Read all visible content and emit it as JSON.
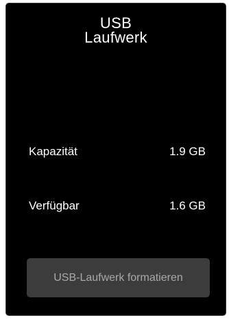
{
  "dialog": {
    "title_line1": "USB",
    "title_line2": "Laufwerk"
  },
  "info": {
    "capacity_label": "Kapazität",
    "capacity_value": "1.9 GB",
    "available_label": "Verfügbar",
    "available_value": "1.6 GB"
  },
  "actions": {
    "format_label": "USB-Laufwerk formatieren"
  },
  "colors": {
    "panel_background": "#000000",
    "text": "#ffffff",
    "button_background": "#3c3c3c",
    "button_text": "#a9a9a9"
  }
}
